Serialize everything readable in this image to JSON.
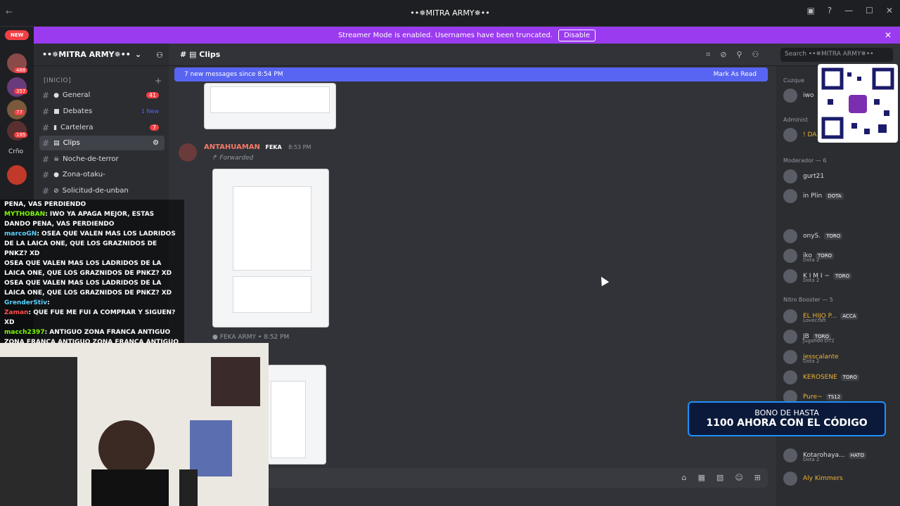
{
  "window": {
    "title": "••✵MITRA ARMY✵••"
  },
  "banner": {
    "text": "Streamer Mode is enabled. Usernames have been truncated.",
    "button": "Disable"
  },
  "guild_badges": {
    "new": "NEW",
    "b1": "488",
    "b2": "357",
    "b3": "77",
    "b4": "195",
    "label": "Crño"
  },
  "server": {
    "name": "••✵MITRA ARMY✵••"
  },
  "category": "[INICIO]",
  "channels": [
    {
      "name": "General",
      "badge": "41"
    },
    {
      "name": "Debates",
      "badge": "1 New"
    },
    {
      "name": "Cartelera",
      "badge": "7"
    },
    {
      "name": "Clips",
      "badge": ""
    },
    {
      "name": "Noche-de-terror",
      "badge": ""
    },
    {
      "name": "Zona-otaku-",
      "badge": ""
    },
    {
      "name": "Solicitud-de-unban",
      "badge": ""
    }
  ],
  "topbar": {
    "channel": "Clips",
    "search_placeholder": "Search ••✵MITRA ARMY✵••"
  },
  "new_messages": {
    "text": "7 new messages since 8:54 PM",
    "mark": "Mark As Read"
  },
  "message": {
    "author": "ANTAHUAMAN",
    "tag": "FEKA",
    "time": "8:53 PM",
    "forwarded": "Forwarded",
    "forward_source": "FEKA ARMY",
    "forward_time": "8:52 PM"
  },
  "members": {
    "groups": [
      {
        "label": "Cuzque"
      },
      {
        "label": "Administ"
      },
      {
        "label": "Moderador — 6"
      },
      {
        "label": "Nitro Booster — 5"
      }
    ],
    "list": [
      {
        "name": "iwo",
        "sub": "",
        "tag": ""
      },
      {
        "name": "! DA",
        "sub": "",
        "tag": ""
      },
      {
        "name": "gurt21",
        "sub": "",
        "tag": ""
      },
      {
        "name": "in Plin",
        "sub": "",
        "tag": "DOTA"
      },
      {
        "name": "onyS.",
        "sub": "",
        "tag": "TORO"
      },
      {
        "name": "iko",
        "sub": "Dota 2",
        "tag": "TORO"
      },
      {
        "name": "K I M I ~",
        "sub": "Dota 2",
        "tag": "TORO"
      },
      {
        "name": "EL HIJO P...",
        "sub": "Lovecraft",
        "tag": "ACCA"
      },
      {
        "name": "JB",
        "sub": "Jugando DT2",
        "tag": "TORO"
      },
      {
        "name": "jesscalante",
        "sub": "Dota 2",
        "tag": ""
      },
      {
        "name": "KEROSENE",
        "sub": "",
        "tag": "TORO"
      },
      {
        "name": "Pure~",
        "sub": "",
        "tag": "TS12"
      },
      {
        "name": "Kotarohaya...",
        "sub": "Dota 2",
        "tag": "HATO"
      },
      {
        "name": "Aly Kimmers",
        "sub": "",
        "tag": ""
      }
    ]
  },
  "promo": {
    "line1": "BONO DE HASTA",
    "line2": "1100 AHORA CON EL CÓDIGO"
  },
  "overlay_chat": [
    {
      "user": "",
      "text": "PENA, VAS PERDIENDO"
    },
    {
      "user": "MYTHOBAN",
      "text": ": IWO YA APAGA MEJOR, ESTAS DANDO PENA, VAS PERDIENDO"
    },
    {
      "user": "marcoGN",
      "text": ": OSEA QUE VALEN MAS LOS LADRIDOS DE LA LAICA ONE, QUE LOS GRAZNIDOS DE PNKZ? XD"
    },
    {
      "user": "",
      "text": "OSEA QUE VALEN MAS LOS LADRIDOS DE LA LAICA ONE, QUE LOS GRAZNIDOS DE PNKZ? XD"
    },
    {
      "user": "",
      "text": "OSEA QUE VALEN MAS LOS LADRIDOS DE LA LAICA ONE, QUE LOS GRAZNIDOS DE PNKZ? XD"
    },
    {
      "user": "GrenderStiv",
      "text": ":"
    },
    {
      "user": "Zaman",
      "text": ": QUE FUE ME FUI A COMPRAR Y SIGUEN? XD"
    },
    {
      "user": "macch2397",
      "text": ": ANTIGUO ZONA FRANCA  ANTIGUO ZONA FRANCA  ANTIGUO ZONA FRANCA  ANTIGUO ZONA FRANCA"
    }
  ]
}
